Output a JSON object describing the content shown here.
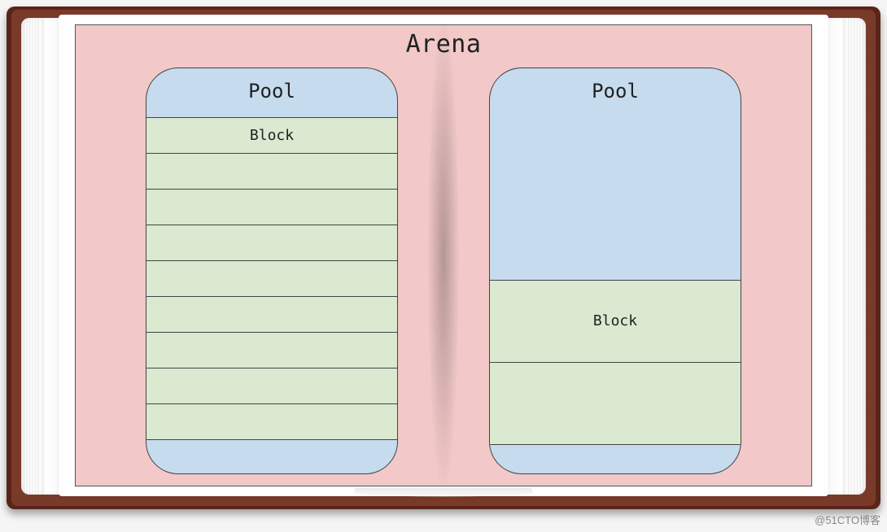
{
  "arena": {
    "title": "Arena",
    "pools": [
      {
        "title": "Pool",
        "blocks": [
          {
            "label": "Block"
          },
          {
            "label": ""
          },
          {
            "label": ""
          },
          {
            "label": ""
          },
          {
            "label": ""
          },
          {
            "label": ""
          },
          {
            "label": ""
          },
          {
            "label": ""
          },
          {
            "label": ""
          }
        ]
      },
      {
        "title": "Pool",
        "blocks": [
          {
            "label": "Block"
          },
          {
            "label": ""
          }
        ]
      }
    ]
  },
  "watermark": "@51CTO博客"
}
